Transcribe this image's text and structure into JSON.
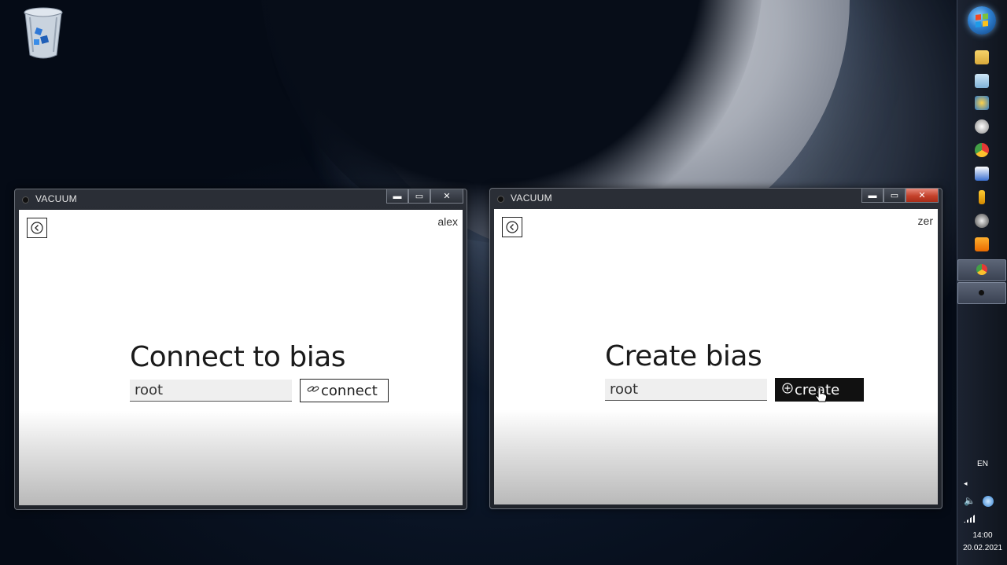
{
  "taskbar": {
    "language": "EN",
    "time": "14:00",
    "date": "20.02.2021"
  },
  "left_window": {
    "title": "VACUUM",
    "user": "alex",
    "heading": "Connect to bias",
    "input_value": "root",
    "button_label": "connect",
    "button_icon": "link-icon",
    "controls": {
      "minimize": "▬",
      "maximize": "▭",
      "close": "✕"
    }
  },
  "right_window": {
    "title": "VACUUM",
    "user": "zer",
    "heading": "Create bias",
    "input_value": "root",
    "button_label": "create",
    "button_icon": "plus-circle-icon",
    "controls": {
      "minimize": "▬",
      "maximize": "▭",
      "close": "✕"
    }
  },
  "colors": {
    "close_red": "#c4412b",
    "create_button_bg": "#111111"
  }
}
